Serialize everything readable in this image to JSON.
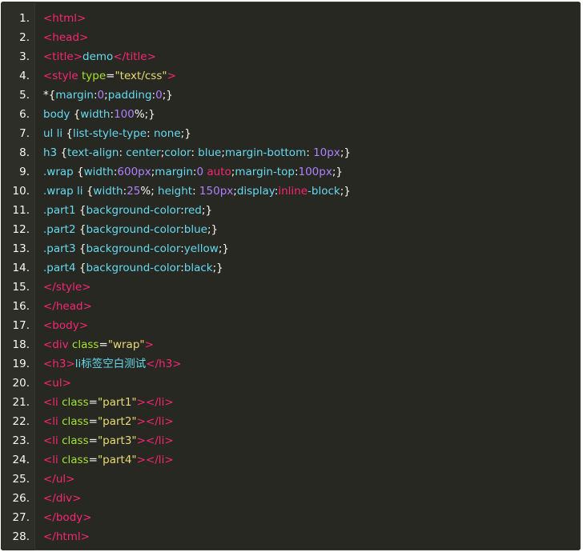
{
  "colors": {
    "background": "#272822",
    "gutter": "#2d2e28",
    "default": "#f8f8f2",
    "tag": "#f92672",
    "attr": "#a6e22e",
    "string": "#e6db74",
    "number": "#ae81ff",
    "property": "#66d9ef"
  },
  "code": {
    "lines": [
      {
        "num": "1.",
        "tokens": [
          {
            "t": "tag",
            "v": "<html>"
          }
        ]
      },
      {
        "num": "2.",
        "tokens": [
          {
            "t": "tag",
            "v": "<head>"
          }
        ]
      },
      {
        "num": "3.",
        "tokens": [
          {
            "t": "tag",
            "v": "<title>"
          },
          {
            "t": "text",
            "v": "demo"
          },
          {
            "t": "tag",
            "v": "</title>"
          }
        ]
      },
      {
        "num": "4.",
        "tokens": [
          {
            "t": "tag",
            "v": "<style "
          },
          {
            "t": "attr",
            "v": "type"
          },
          {
            "t": "punc",
            "v": "="
          },
          {
            "t": "str",
            "v": "\"text/css\""
          },
          {
            "t": "tag",
            "v": ">"
          }
        ]
      },
      {
        "num": "5.",
        "tokens": [
          {
            "t": "punc",
            "v": "*{"
          },
          {
            "t": "prop",
            "v": "margin"
          },
          {
            "t": "punc",
            "v": ":"
          },
          {
            "t": "num",
            "v": "0"
          },
          {
            "t": "punc",
            "v": ";"
          },
          {
            "t": "prop",
            "v": "padding"
          },
          {
            "t": "punc",
            "v": ":"
          },
          {
            "t": "num",
            "v": "0"
          },
          {
            "t": "punc",
            "v": ";}"
          }
        ]
      },
      {
        "num": "6.",
        "tokens": [
          {
            "t": "sel",
            "v": "body "
          },
          {
            "t": "punc",
            "v": "{"
          },
          {
            "t": "prop",
            "v": "width"
          },
          {
            "t": "punc",
            "v": ":"
          },
          {
            "t": "num",
            "v": "100"
          },
          {
            "t": "punc",
            "v": "%;}"
          }
        ]
      },
      {
        "num": "7.",
        "tokens": [
          {
            "t": "sel",
            "v": "ul li "
          },
          {
            "t": "punc",
            "v": "{"
          },
          {
            "t": "prop",
            "v": "list-style-type"
          },
          {
            "t": "punc",
            "v": ": "
          },
          {
            "t": "val",
            "v": "none"
          },
          {
            "t": "punc",
            "v": ";}"
          }
        ]
      },
      {
        "num": "8.",
        "tokens": [
          {
            "t": "sel",
            "v": "h3 "
          },
          {
            "t": "punc",
            "v": "{"
          },
          {
            "t": "prop",
            "v": "text-align"
          },
          {
            "t": "punc",
            "v": ": "
          },
          {
            "t": "val",
            "v": "center"
          },
          {
            "t": "punc",
            "v": ";"
          },
          {
            "t": "prop",
            "v": "color"
          },
          {
            "t": "punc",
            "v": ": "
          },
          {
            "t": "val",
            "v": "blue"
          },
          {
            "t": "punc",
            "v": ";"
          },
          {
            "t": "prop",
            "v": "margin-bottom"
          },
          {
            "t": "punc",
            "v": ": "
          },
          {
            "t": "num",
            "v": "10px"
          },
          {
            "t": "punc",
            "v": ";}"
          }
        ]
      },
      {
        "num": "9.",
        "tokens": [
          {
            "t": "sel",
            "v": ".wrap "
          },
          {
            "t": "punc",
            "v": "{"
          },
          {
            "t": "prop",
            "v": "width"
          },
          {
            "t": "punc",
            "v": ":"
          },
          {
            "t": "num",
            "v": "600px"
          },
          {
            "t": "punc",
            "v": ";"
          },
          {
            "t": "prop",
            "v": "margin"
          },
          {
            "t": "punc",
            "v": ":"
          },
          {
            "t": "num",
            "v": "0 "
          },
          {
            "t": "kw",
            "v": "auto"
          },
          {
            "t": "punc",
            "v": ";"
          },
          {
            "t": "prop",
            "v": "margin-top"
          },
          {
            "t": "punc",
            "v": ":"
          },
          {
            "t": "num",
            "v": "100px"
          },
          {
            "t": "punc",
            "v": ";}"
          }
        ]
      },
      {
        "num": "10.",
        "tokens": [
          {
            "t": "sel",
            "v": ".wrap li "
          },
          {
            "t": "punc",
            "v": "{"
          },
          {
            "t": "prop",
            "v": "width"
          },
          {
            "t": "punc",
            "v": ":"
          },
          {
            "t": "num",
            "v": "25"
          },
          {
            "t": "punc",
            "v": "%; "
          },
          {
            "t": "prop",
            "v": "height"
          },
          {
            "t": "punc",
            "v": ": "
          },
          {
            "t": "num",
            "v": "150px"
          },
          {
            "t": "punc",
            "v": ";"
          },
          {
            "t": "prop",
            "v": "display"
          },
          {
            "t": "punc",
            "v": ":"
          },
          {
            "t": "kw",
            "v": "inline"
          },
          {
            "t": "val",
            "v": "-block"
          },
          {
            "t": "punc",
            "v": ";}"
          }
        ]
      },
      {
        "num": "11.",
        "tokens": [
          {
            "t": "sel",
            "v": ".part1 "
          },
          {
            "t": "punc",
            "v": "{"
          },
          {
            "t": "prop",
            "v": "background-color"
          },
          {
            "t": "punc",
            "v": ":"
          },
          {
            "t": "val",
            "v": "red"
          },
          {
            "t": "punc",
            "v": ";}"
          }
        ]
      },
      {
        "num": "12.",
        "tokens": [
          {
            "t": "sel",
            "v": ".part2 "
          },
          {
            "t": "punc",
            "v": "{"
          },
          {
            "t": "prop",
            "v": "background-color"
          },
          {
            "t": "punc",
            "v": ":"
          },
          {
            "t": "val",
            "v": "blue"
          },
          {
            "t": "punc",
            "v": ";}"
          }
        ]
      },
      {
        "num": "13.",
        "tokens": [
          {
            "t": "sel",
            "v": ".part3 "
          },
          {
            "t": "punc",
            "v": "{"
          },
          {
            "t": "prop",
            "v": "background-color"
          },
          {
            "t": "punc",
            "v": ":"
          },
          {
            "t": "val",
            "v": "yellow"
          },
          {
            "t": "punc",
            "v": ";}"
          }
        ]
      },
      {
        "num": "14.",
        "tokens": [
          {
            "t": "sel",
            "v": ".part4 "
          },
          {
            "t": "punc",
            "v": "{"
          },
          {
            "t": "prop",
            "v": "background-color"
          },
          {
            "t": "punc",
            "v": ":"
          },
          {
            "t": "val",
            "v": "black"
          },
          {
            "t": "punc",
            "v": ";}"
          }
        ]
      },
      {
        "num": "15.",
        "tokens": [
          {
            "t": "tag",
            "v": "</style>"
          }
        ]
      },
      {
        "num": "16.",
        "tokens": [
          {
            "t": "tag",
            "v": "</head>"
          }
        ]
      },
      {
        "num": "17.",
        "tokens": [
          {
            "t": "tag",
            "v": "<body>"
          }
        ]
      },
      {
        "num": "18.",
        "tokens": [
          {
            "t": "tag",
            "v": "<div "
          },
          {
            "t": "attr",
            "v": "class"
          },
          {
            "t": "punc",
            "v": "="
          },
          {
            "t": "str",
            "v": "\"wrap\""
          },
          {
            "t": "tag",
            "v": ">"
          }
        ]
      },
      {
        "num": "19.",
        "tokens": [
          {
            "t": "tag",
            "v": "<h3>"
          },
          {
            "t": "text",
            "v": "li标签空白测试"
          },
          {
            "t": "tag",
            "v": "</h3>"
          }
        ]
      },
      {
        "num": "20.",
        "tokens": [
          {
            "t": "tag",
            "v": "<ul>"
          }
        ]
      },
      {
        "num": "21.",
        "tokens": [
          {
            "t": "tag",
            "v": "<li "
          },
          {
            "t": "attr",
            "v": "class"
          },
          {
            "t": "punc",
            "v": "="
          },
          {
            "t": "str",
            "v": "\"part1\""
          },
          {
            "t": "tag",
            "v": "></li>"
          }
        ]
      },
      {
        "num": "22.",
        "tokens": [
          {
            "t": "tag",
            "v": "<li "
          },
          {
            "t": "attr",
            "v": "class"
          },
          {
            "t": "punc",
            "v": "="
          },
          {
            "t": "str",
            "v": "\"part2\""
          },
          {
            "t": "tag",
            "v": "></li>"
          }
        ]
      },
      {
        "num": "23.",
        "tokens": [
          {
            "t": "tag",
            "v": "<li "
          },
          {
            "t": "attr",
            "v": "class"
          },
          {
            "t": "punc",
            "v": "="
          },
          {
            "t": "str",
            "v": "\"part3\""
          },
          {
            "t": "tag",
            "v": "></li>"
          }
        ]
      },
      {
        "num": "24.",
        "tokens": [
          {
            "t": "tag",
            "v": "<li "
          },
          {
            "t": "attr",
            "v": "class"
          },
          {
            "t": "punc",
            "v": "="
          },
          {
            "t": "str",
            "v": "\"part4\""
          },
          {
            "t": "tag",
            "v": "></li>"
          }
        ]
      },
      {
        "num": "25.",
        "tokens": [
          {
            "t": "tag",
            "v": "</ul>"
          }
        ]
      },
      {
        "num": "26.",
        "tokens": [
          {
            "t": "tag",
            "v": "</div>"
          }
        ]
      },
      {
        "num": "27.",
        "tokens": [
          {
            "t": "tag",
            "v": "</body>"
          }
        ]
      },
      {
        "num": "28.",
        "tokens": [
          {
            "t": "tag",
            "v": "</html>"
          }
        ]
      }
    ]
  }
}
